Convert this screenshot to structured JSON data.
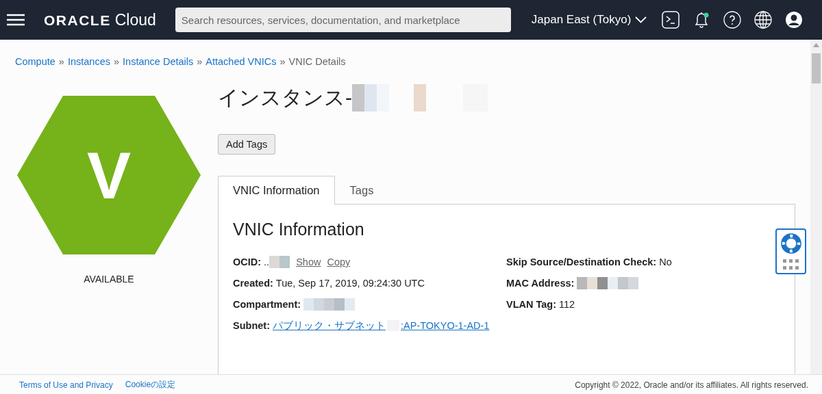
{
  "header": {
    "logo": {
      "brand": "ORACLE",
      "product": "Cloud"
    },
    "search": {
      "placeholder": "Search resources, services, documentation, and marketplace"
    },
    "region": "Japan East (Tokyo)",
    "unread_notifications": true
  },
  "breadcrumb": [
    {
      "label": "Compute",
      "link": true
    },
    {
      "separator": "»",
      "label": "Instances",
      "link": true
    },
    {
      "separator": "»",
      "label": "Instance Details",
      "link": true
    },
    {
      "separator": "»",
      "label": "Attached VNICs",
      "link": true
    },
    {
      "separator": "»",
      "label": "VNIC Details",
      "link": false
    }
  ],
  "resource": {
    "letter": "V",
    "state": "AVAILABLE",
    "title": "インスタンス-",
    "title_redacted": true
  },
  "buttons": [
    "Add Tags"
  ],
  "tabs": [
    {
      "label": "VNIC Information",
      "selected": true
    },
    {
      "label": "Tags",
      "selected": false
    }
  ],
  "section": {
    "heading": "VNIC Information",
    "left": [
      {
        "kind": "text",
        "label": "OCID:",
        "value": "..",
        "redacted": true,
        "actions": [
          "Show",
          "Copy"
        ]
      },
      {
        "kind": "text",
        "label": "Created:",
        "value": "Tue, Sep 17, 2019, 09:24:30 UTC",
        "redacted": false
      },
      {
        "kind": "text",
        "label": "Compartment:",
        "redacted": true
      },
      {
        "kind": "link",
        "label": "Subnet:",
        "links": [
          "パブリック・サブネット",
          ":AP-TOKYO-1-AD-",
          "1"
        ],
        "redacted": true
      }
    ],
    "right": [
      {
        "kind": "text",
        "label": "Skip Source/Destination Check:",
        "value": "No",
        "redacted": false
      },
      {
        "kind": "text",
        "label": "MAC Address:",
        "redacted": true
      },
      {
        "kind": "text",
        "label": "VLAN Tag:",
        "value": "112",
        "redacted": false
      }
    ]
  },
  "footer": {
    "links": [
      "Terms of Use and Privacy",
      "Cookieの設定"
    ],
    "copyright": "Copyright © 2022, Oracle and/or its affiliates. All rights reserved."
  }
}
